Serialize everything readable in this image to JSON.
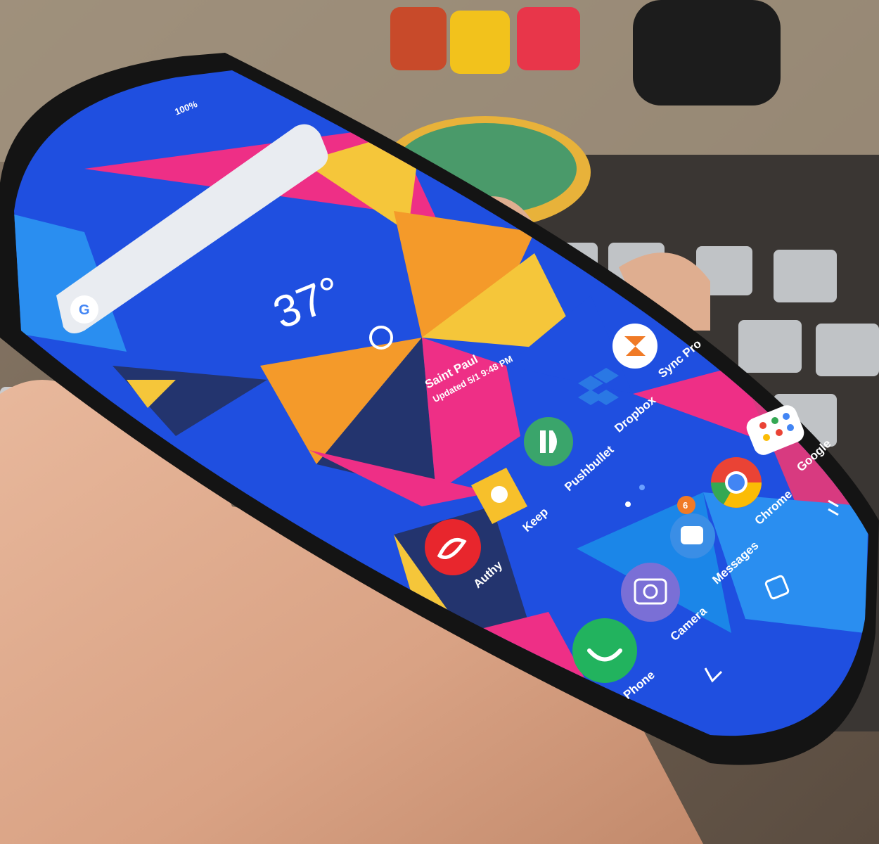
{
  "status_bar": {
    "battery": "100%"
  },
  "search_bar": {
    "provider_letter": "G"
  },
  "weather": {
    "temperature": "37°",
    "location": "Saint Paul",
    "updated": "Updated 5/1 9:48 PM"
  },
  "apps": [
    {
      "name": "Sync Pro",
      "icon": "sync-pro-icon",
      "color": "#ffffff"
    },
    {
      "name": "Dropbox",
      "icon": "dropbox-icon",
      "color": "#2a78e4"
    },
    {
      "name": "Pushbullet",
      "icon": "pushbullet-icon",
      "color": "#3aa56b"
    },
    {
      "name": "Keep",
      "icon": "keep-icon",
      "color": "#f7c02b"
    },
    {
      "name": "Authy",
      "icon": "authy-icon",
      "color": "#e8262d"
    },
    {
      "name": "Google",
      "icon": "google-folder-icon",
      "color": "#ffffff"
    },
    {
      "name": "Chrome",
      "icon": "chrome-icon",
      "color": "#ffffff"
    },
    {
      "name": "Messages",
      "icon": "messages-icon",
      "color": "#3a8ee6"
    },
    {
      "name": "Camera",
      "icon": "camera-icon",
      "color": "#7a6fd6"
    },
    {
      "name": "Phone",
      "icon": "phone-icon",
      "color": "#22b35e"
    }
  ],
  "messages_badge": "6",
  "navigation": {
    "recents": "recents-icon",
    "home": "home-icon",
    "back": "back-icon"
  },
  "colors": {
    "wallpaper_blue": "#1f4fe0",
    "wallpaper_orange": "#f49a2a",
    "wallpaper_pink": "#ee2f86",
    "wallpaper_navy": "#23346e",
    "wallpaper_yellow": "#f5c63a"
  }
}
